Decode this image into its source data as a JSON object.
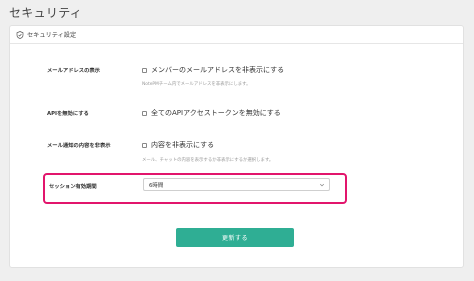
{
  "page": {
    "title": "セキュリティ"
  },
  "card": {
    "header_title": "セキュリティ設定"
  },
  "settings": [
    {
      "label": "メールアドレスの表示",
      "option": "メンバーのメールアドレスを非表示にする",
      "help": "NotePMチーム内でメールアドレスを非表示にします。"
    },
    {
      "label": "APIを無効にする",
      "option": "全てのAPIアクセストークンを無効にする",
      "help": ""
    },
    {
      "label": "メール通知の内容を非表示",
      "option": "内容を非表示にする",
      "help": "メール、チャットの内容を表示するか非表示にするか選択します。"
    }
  ],
  "session": {
    "label": "セッション有効期間",
    "selected_value": "6時間",
    "highlight_color": "#e2156c"
  },
  "actions": {
    "update_label": "更新する",
    "update_color": "#2fae94"
  }
}
